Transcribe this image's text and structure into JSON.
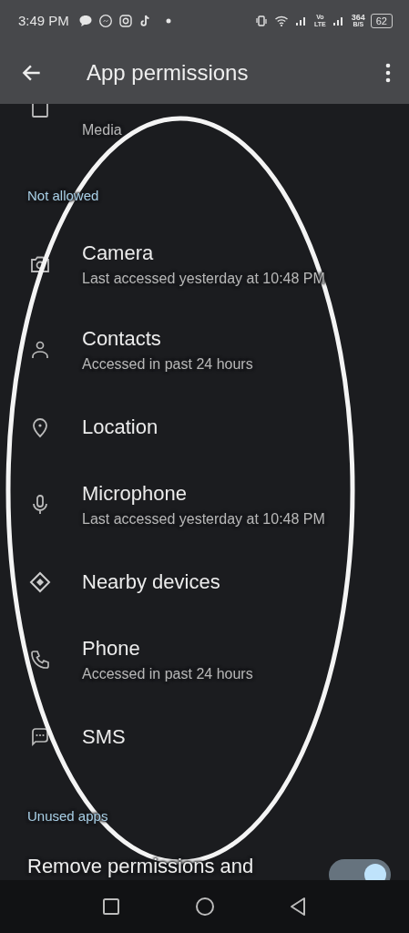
{
  "status_bar": {
    "time": "3:49 PM",
    "volte_top": "Vo",
    "volte_bottom": "LTE",
    "speed_value": "364",
    "speed_unit": "B/S",
    "battery": "62"
  },
  "app_bar": {
    "title": "App permissions"
  },
  "top_item": {
    "subtitle": "Media"
  },
  "not_allowed": {
    "header": "Not allowed",
    "items": [
      {
        "title": "Camera",
        "subtitle": "Last accessed yesterday at 10:48 PM"
      },
      {
        "title": "Contacts",
        "subtitle": "Accessed in past 24 hours"
      },
      {
        "title": "Location"
      },
      {
        "title": "Microphone",
        "subtitle": "Last accessed yesterday at 10:48 PM"
      },
      {
        "title": "Nearby devices"
      },
      {
        "title": "Phone",
        "subtitle": "Accessed in past 24 hours"
      },
      {
        "title": "SMS"
      }
    ]
  },
  "unused": {
    "header": "Unused apps",
    "title": "Remove permissions and",
    "on": true
  }
}
